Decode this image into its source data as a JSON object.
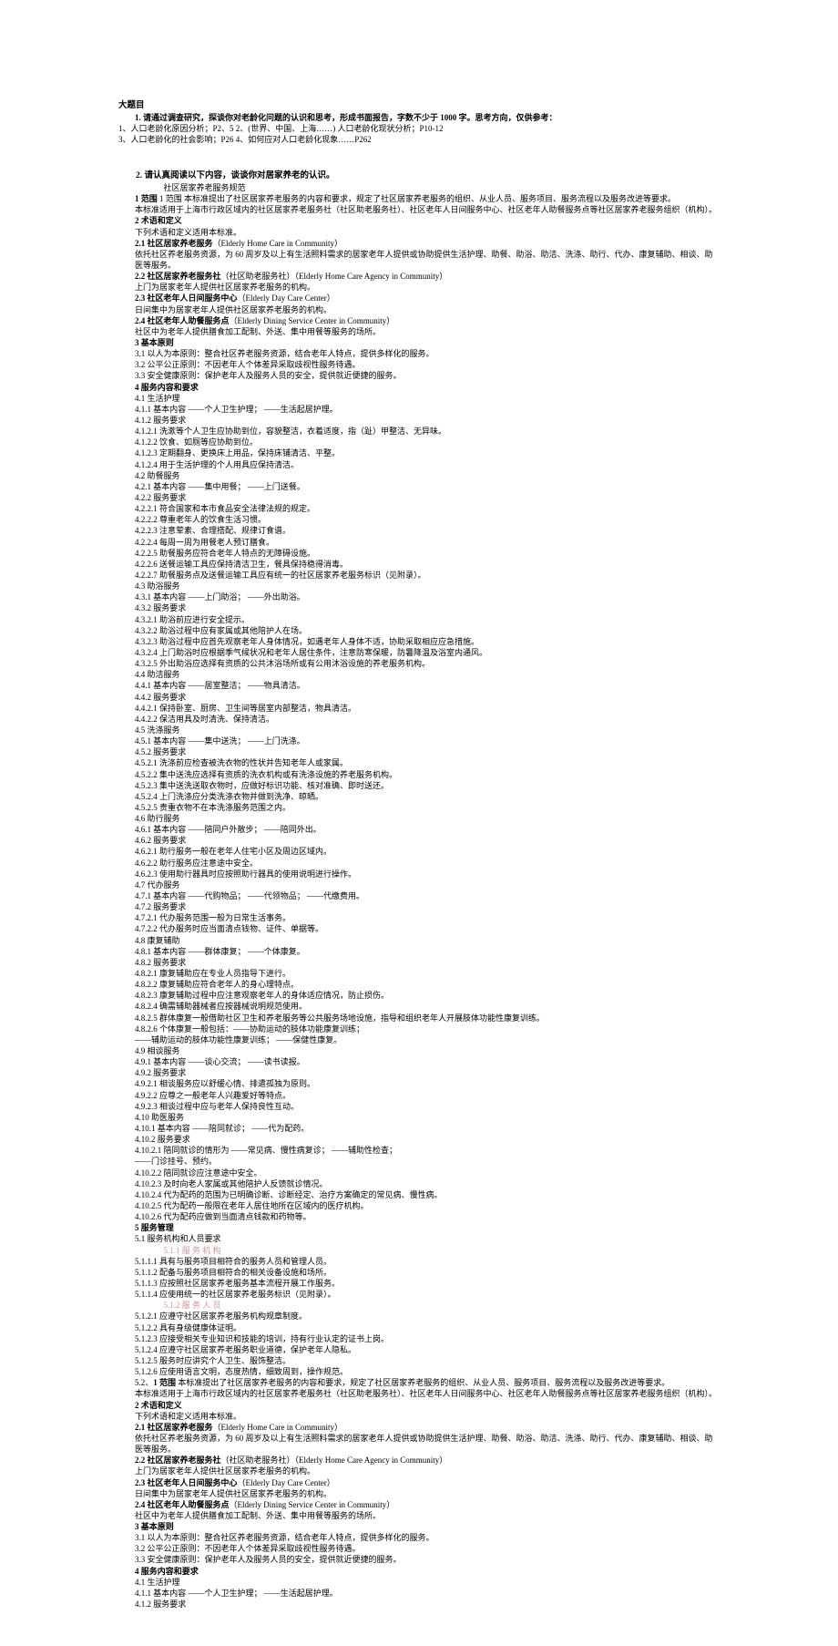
{
  "topic": "大题目",
  "q1": "1. 请通过调查研究，探谈你对老龄化问题的认识和思考，形成书面报告，字数不少于 1000 字。思考方向，仅供参考：",
  "q1a": "1、人口老龄化原因分析；P2、5   2、(世界、中国、上海……) 人口老龄化现状分析；P10-12",
  "q1b": "3、人口老龄化的社会影响；P26 4、如何应对人口老龄化现象……P262",
  "q2": "2. 请认真阅读以下内容，谈谈你对居家养老的认识。",
  "title2": "社区居家养老服务规范",
  "s1": "1 范围  本标准提出了社区居家养老服务的内容和要求，规定了社区居家养老服务的组织、从业人员、服务项目、服务流程以及服务改进等要求。",
  "s1b": "本标准适用于上海市行政区域内的社区居家养老服务社（社区助老服务社）、社区老年人日间服务中心、社区老年人助餐服务点等社区居家养老服务组织（机构）。",
  "s2": "2 术语和定义",
  "s2a": "下列术语和定义适用本标准。",
  "s21": "2.1 社区居家养老服务（Elderly Home Care in Community）",
  "s21a": "依托社区养老服务资源，为 60 周岁及以上有生活照料需求的居家老年人提供或协助提供生活护理、助餐、助浴、助洁、洗涤、助行、代办、康复辅助、相谈、助医等服务。",
  "s22": "2.2 社区居家养老服务社（社区助老服务社）（Elderly Home Care Agency in Community）",
  "s22a": "上门为居家老年人提供社区居家养老服务的机构。",
  "s23": "2.3 社区老年人日间服务中心（Elderly Day Care Center）",
  "s23a": "日间集中为居家老年人提供社区居家养老服务的机构。",
  "s24": "2.4 社区老年人助餐服务点（Elderly Dining Service Center in Community）",
  "s24a": "社区中为老年人提供膳食加工配制、外送、集中用餐等服务的场所。",
  "s3": "3 基本原则",
  "s31": "3.1 以人为本原则：整合社区养老服务资源，结合老年人特点，提供多样化的服务。",
  "s32": "3.2 公平公正原则：不因老年人个体差异采取歧视性服务待遇。",
  "s33": "3.3 安全健康原则：保护老年人及服务人员的安全，提供就近便捷的服务。",
  "s4": "4 服务内容和要求",
  "s41": "4.1 生活护理",
  "s411": "4.1.1 基本内容       ——个人卫生护理；   ——生活起居护理。",
  "s412": "4.1.2 服务要求",
  "s4121": "4.1.2.1 洗漱等个人卫生应协助到位，容貌整洁，衣着适度，指（趾）甲整洁、无异味。",
  "s4122": "4.1.2.2 饮食、如厕等应协助到位。",
  "s4123": "4.1.2.3 定期翻身、更换床上用品，保持床铺清洁、平整。",
  "s4124": "4.1.2.4 用于生活护理的个人用具应保持清洁。",
  "s42": "4.2 助餐服务",
  "s421": "4.2.1 基本内容       ——集中用餐；       ——上门送餐。",
  "s422": "4.2.2 服务要求",
  "s4221": "4.2.2.1 符合国家和本市食品安全法律法规的规定。",
  "s4222": "4.2.2.2 尊重老年人的饮食生活习惯。",
  "s4223": "4.2.2.3 注意荤素、合理搭配、规律订食谱。",
  "s4224": "4.2.2.4 每周一周为用餐老人预订膳食。",
  "s4225": "4.2.2.5 助餐服务应符合老年人特点的无障碍设施。",
  "s4226": "4.2.2.6 送餐运输工具应保持清洁卫生，餐具保持稳得消毒。",
  "s4227": "4.2.2.7 助餐服务点及送餐运输工具应有统一的社区居家养老服务标识（见附录）。",
  "s43": "4.3 助浴服务",
  "s431": "4.3.1 基本内容       ——上门助浴；       ——外出助浴。",
  "s432": "4.3.2 服务要求",
  "s4321": "4.3.2.1 助浴前应进行安全提示。",
  "s4322": "4.3.2.2 助浴过程中应有家属或其他陪护人在场。",
  "s4323": "4.3.2.3 助浴过程中应首先观察老年人身体情况，如遇老年人身体不适，协助采取相应应急措施。",
  "s4324": "4.3.2.4 上门助浴时应根据季气候状况和老年人居住条件，注意防寒保暖，防暑降温及浴室内通风。",
  "s4325": "4.3.2.5 外出助浴应选择有资质的公共沐浴场所或有公用沐浴设施的养老服务机构。",
  "s44": "4.4 助洁服务",
  "s441": "4.4.1 基本内容       ——居室整洁；       ——物具清洁。",
  "s442": "4.4.2 服务要求",
  "s4421": "4.4.2.1 保持卧室、厨房、卫生间等居室内部整洁，物具清洁。",
  "s4422": "4.4.2.2 保洁用具及时清洗、保持清洁。",
  "s45": "4.5 洗涤服务",
  "s451": "4.5.1 基本内容       ——集中送洗；       ——上门洗涤。",
  "s452": "4.5.2 服务要求",
  "s4521": "4.5.2.1 洗涤前应检查被洗衣物的性状并告知老年人或家属。",
  "s4522": "4.5.2.2 集中送洗应选择有资质的洗衣机构或有洗涤设施的养老服务机构。",
  "s4523": "4.5.2.3 集中送洗送取衣物时，应做好标识功能、核对准确、即时送还。",
  "s4524": "4.5.2.4 上门洗涤应分类洗涤衣物并做到洗净、晾晒。",
  "s4525": "4.5.2.5 贵重衣物不在本洗涤服务范围之内。",
  "s46": "4.6 助行服务",
  "s461": "4.6.1 基本内容       ——陪同户外散步；   ——陪同外出。",
  "s462": "4.6.2 服务要求",
  "s4621": "4.6.2.1 助行服务一般在老年人住宅小区及周边区域内。",
  "s4622": "4.6.2.2 助行服务应注意途中安全。",
  "s4623": "4.6.2.3 使用助行器具时应按照助行器具的使用说明进行操作。",
  "s47": "4.7 代办服务",
  "s471": "4.7.1 基本内容       ——代购物品；   ——代领物品；       ——代缴费用。",
  "s472": "4.7.2 服务要求",
  "s4721": "4.7.2.1 代办服务范围一般为日常生活事务。",
  "s4722": "4.7.2.2 代办服务时应当面清点钱物、证件、单据等。",
  "s48": "4.8 康复辅助",
  "s481": "4.8.1 基本内容       ——群体康复；       ——个体康复。",
  "s482": "4.8.2 服务要求",
  "s4821": "4.8.2.1 康复辅助应在专业人员指导下进行。",
  "s4822": "4.8.2.2 康复辅助应符合老年人的身心理特点。",
  "s4823": "4.8.2.3 康复辅助过程中应注意观察老年人的身体适应情况，防止损伤。",
  "s4824": "4.8.2.4 确需辅助器械者应按器械说明规范使用。",
  "s4825": "4.8.2.5 群体康复一般借助社区卫生和养老服务等公共服务场地设施，指导和组织老年人开展肢体功能性康复训练。",
  "s4826": "4.8.2.6 个体康复一般包括：——协助运动的肢体功能康复训练；",
  "s4826b": "——辅助运动的肢体功能性康复训练；       ——保健性康复。",
  "s49": "4.9 相谈服务",
  "s491": "4.9.1 基本内容       ——谈心交流；       ——读书读报。",
  "s492": "4.9.2 服务要求",
  "s4921": "4.9.2.1 相谈服务应以舒缓心情、排遣孤独为原则。",
  "s4922": "4.9.2.2 应尊之一般老年人兴趣爱好等特点。",
  "s4923": "4.9.2.3 相谈过程中应与老年人保持良性互动。",
  "s410": "4.10 助医服务",
  "s4101": "4.10.1 基本内容     ——陪同就诊；   ——代为配药。",
  "s4102": "4.10.2 服务要求",
  "s41021": "4.10.2.1 陪同就诊的情形为       ——常见病、慢性病复诊；   ——辅助性检查；",
  "s41021b": "——门诊挂号、预约。",
  "s41022": "4.10.2.2 陪同就诊应注意途中安全。",
  "s41023": "4.10.2.3 及时向老人家属或其他陪护人反馈就诊情况。",
  "s41024": "4.10.2.4 代为配药的范围为已明确诊断、诊断经定、治疗方案确定的常见病、慢性病。",
  "s41025": "4.10.2.5 代为配药一般限在老年人居住地所在区域内的医疗机构。",
  "s41026": "4.10.2.6 代为配药应做到当面清点钱款和药物等。",
  "s5": "5 服务管理",
  "s51": "5.1 服务机构和人员要求",
  "s511": "5.1.1 服 务 机 构",
  "s5111": "5.1.1.1 具有与服务项目相符合的服务人员和管理人员。",
  "s5112": "5.1.1.2 配备与服务项目相符合的相关设备设施和场所。",
  "s5113": "5.1.1.3 应按照社区居家养老服务基本流程开展工作服务。",
  "s5114": "5.1.1.4 应使用统一的社区居家养老服务标识（见附录）。",
  "s512": "5.1.2 服 务 人 员",
  "s5121": "5.1.2.1 应遵守社区居家养老服务机构规章制度。",
  "s5122": "5.1.2.2 具有身级健康体证明。",
  "s5123": "5.1.2.3 应接受相关专业知识和技能的培训，持有行业认定的证书上岗。",
  "s5124": "5.1.2.4 应遵守社区居家养老服务职业道德，保护老年人隐私。",
  "s5125": "5.1.2.5 服务时应讲究个人卫生、服饰整洁。",
  "s5126": "5.1.2.6 应使用语言文明，态度热情，细致周到，操作规范。",
  "s52": "5.2、1 范围  本标准提出了社区居家养老服务的内容和要求，规定了社区居家养老服务的组织、从业人员、服务项目、服务流程以及服务改进等要求。"
}
